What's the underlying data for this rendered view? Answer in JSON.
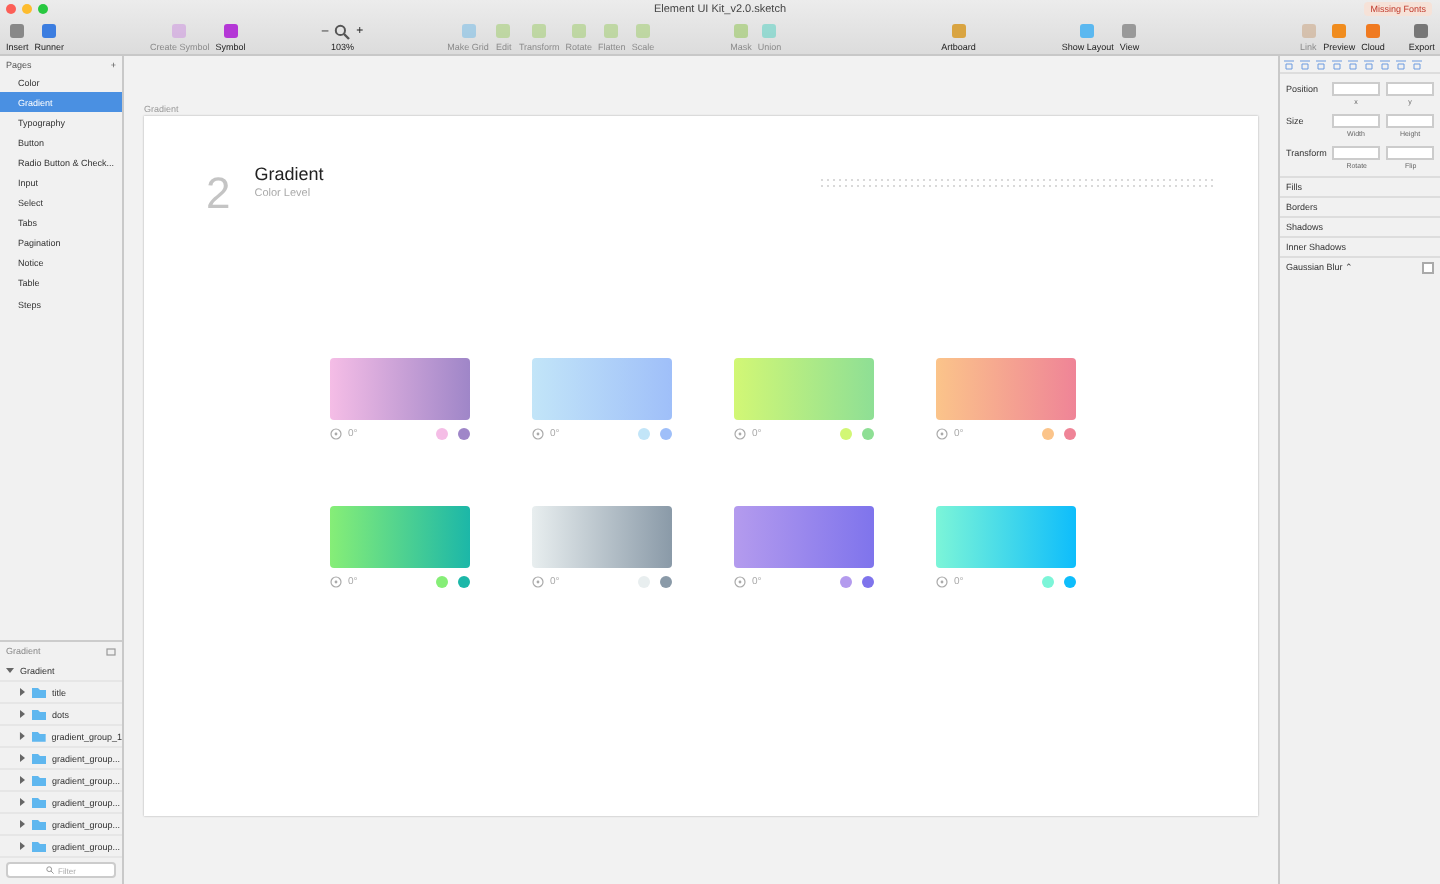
{
  "window": {
    "title": "Element UI Kit_v2.0.sketch",
    "badge": "Missing Fonts"
  },
  "toolbar": {
    "groups": [
      {
        "items": [
          {
            "kind": "insert",
            "label": "Insert",
            "disabled": false
          },
          {
            "kind": "runner",
            "label": "Runner",
            "disabled": false
          }
        ]
      },
      {
        "items": [
          {
            "kind": "symbol-create",
            "label": "Create Symbol",
            "disabled": true
          },
          {
            "kind": "symbol",
            "label": "Symbol",
            "disabled": false
          }
        ]
      },
      {
        "items": [
          {
            "kind": "zoom",
            "label": "103%",
            "minus": "–",
            "plus": "+",
            "disabled": false
          }
        ]
      },
      {
        "items": [
          {
            "kind": "grid",
            "label": "Make Grid",
            "disabled": true
          },
          {
            "kind": "edit",
            "label": "Edit",
            "disabled": true
          },
          {
            "kind": "transform",
            "label": "Transform",
            "disabled": true
          },
          {
            "kind": "rotate",
            "label": "Rotate",
            "disabled": true
          },
          {
            "kind": "flatten",
            "label": "Flatten",
            "disabled": true
          },
          {
            "kind": "scale",
            "label": "Scale",
            "disabled": true
          }
        ]
      },
      {
        "items": [
          {
            "kind": "mask",
            "label": "Mask",
            "disabled": true
          },
          {
            "kind": "union",
            "label": "Union",
            "disabled": true
          }
        ]
      },
      {
        "items": [
          {
            "kind": "artboard",
            "label": "Artboard",
            "disabled": false
          }
        ]
      },
      {
        "items": [
          {
            "kind": "layout",
            "label": "Show Layout",
            "disabled": false
          },
          {
            "kind": "view",
            "label": "View",
            "disabled": false
          }
        ]
      },
      {
        "items": [
          {
            "kind": "link",
            "label": "Link",
            "disabled": true
          },
          {
            "kind": "preview",
            "label": "Preview",
            "disabled": false
          },
          {
            "kind": "cloud",
            "label": "Cloud",
            "disabled": false
          }
        ]
      },
      {
        "items": [
          {
            "kind": "export",
            "label": "Export",
            "disabled": false
          }
        ]
      }
    ]
  },
  "pages": {
    "title": "Pages",
    "add": "+",
    "items": [
      {
        "label": "Color",
        "selected": false
      },
      {
        "label": "Gradient",
        "selected": true
      },
      {
        "label": "Typography",
        "selected": false
      },
      {
        "label": "Button",
        "selected": false
      },
      {
        "label": "Radio Button & Check...",
        "selected": false
      },
      {
        "label": "Input",
        "selected": false
      },
      {
        "label": "Select",
        "selected": false
      },
      {
        "label": "Tabs",
        "selected": false
      },
      {
        "label": "Pagination",
        "selected": false
      },
      {
        "label": "Notice",
        "selected": false
      },
      {
        "label": "Table",
        "selected": false
      },
      {
        "label": "Steps",
        "selected": false
      }
    ]
  },
  "layers": {
    "title": "Gradient",
    "filter_placeholder": "Filter",
    "items": [
      {
        "name": "Gradient",
        "expanded": true,
        "children": [
          {
            "name": "title",
            "expanded": false
          },
          {
            "name": "dots",
            "expanded": false
          },
          {
            "name": "gradient_group_1",
            "expanded": false
          },
          {
            "name": "gradient_group...",
            "expanded": false
          },
          {
            "name": "gradient_group...",
            "expanded": false
          },
          {
            "name": "gradient_group...",
            "expanded": false
          },
          {
            "name": "gradient_group...",
            "expanded": false
          },
          {
            "name": "gradient_group...",
            "expanded": false
          }
        ]
      }
    ]
  },
  "canvas": {
    "artboard_label": "Gradient",
    "number": "2",
    "title": "Gradient",
    "subtitle": "Color Level",
    "swatches": [
      {
        "angle": "0°",
        "stops": [
          {
            "color": "#f5bde6"
          },
          {
            "color": "#9f86c8"
          }
        ]
      },
      {
        "angle": "0°",
        "stops": [
          {
            "color": "#c2e5f8"
          },
          {
            "color": "#9fbff9"
          }
        ]
      },
      {
        "angle": "0°",
        "stops": [
          {
            "color": "#d2f775"
          },
          {
            "color": "#8edf95"
          }
        ]
      },
      {
        "angle": "0°",
        "stops": [
          {
            "color": "#fbc48a"
          },
          {
            "color": "#ef8497"
          }
        ]
      },
      {
        "angle": "0°",
        "stops": [
          {
            "color": "#86ee77"
          },
          {
            "color": "#1cb7a8"
          }
        ]
      },
      {
        "angle": "0°",
        "stops": [
          {
            "color": "#e8eeef"
          },
          {
            "color": "#8a9aa8"
          }
        ]
      },
      {
        "angle": "0°",
        "stops": [
          {
            "color": "#b49bee"
          },
          {
            "color": "#7f74ec"
          }
        ]
      },
      {
        "angle": "0°",
        "stops": [
          {
            "color": "#7cf5d8"
          },
          {
            "color": "#0ebdfb"
          }
        ]
      }
    ]
  },
  "inspector": {
    "position": {
      "label": "Position",
      "x": "x",
      "y": "y"
    },
    "size": {
      "label": "Size",
      "w": "Width",
      "h": "Height"
    },
    "transform": {
      "label": "Transform",
      "rotate": "Rotate",
      "flip": "Flip"
    },
    "sections": [
      {
        "label": "Fills"
      },
      {
        "label": "Borders"
      },
      {
        "label": "Shadows"
      },
      {
        "label": "Inner Shadows"
      },
      {
        "label": "Gaussian Blur",
        "toggle": "⌃",
        "checked": false
      }
    ]
  }
}
